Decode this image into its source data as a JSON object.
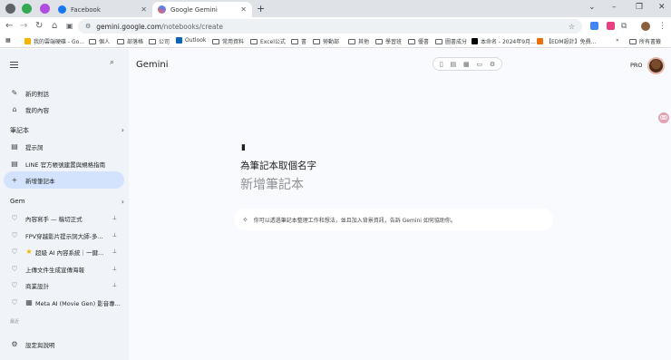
{
  "browser": {
    "tabs": [
      {
        "title": "Facebook",
        "active": false
      },
      {
        "title": "Google Gemini",
        "active": true
      }
    ],
    "new_tab": "+",
    "window_controls": [
      "⌄",
      "–",
      "❐",
      "✕"
    ],
    "url_host": "gemini.google.com",
    "url_path": "/notebooks/create"
  },
  "bookmarks": [
    {
      "label": "我的雲端硬碟 - Go...",
      "kind": "drive"
    },
    {
      "label": "個人",
      "kind": "folder"
    },
    {
      "label": "部落格",
      "kind": "folder"
    },
    {
      "label": "公司",
      "kind": "folder"
    },
    {
      "label": "Outlook",
      "kind": "outlook"
    },
    {
      "label": "常用資料",
      "kind": "folder"
    },
    {
      "label": "Excel公式",
      "kind": "folder"
    },
    {
      "label": "書",
      "kind": "folder"
    },
    {
      "label": "勞動部",
      "kind": "folder"
    },
    {
      "label": "其他",
      "kind": "folder"
    },
    {
      "label": "學習班",
      "kind": "folder"
    },
    {
      "label": "優書",
      "kind": "folder"
    },
    {
      "label": "圖書成分",
      "kind": "folder"
    },
    {
      "label": "本命名 - 2024年9月...",
      "kind": "notion"
    },
    {
      "label": "【EDM設計】免費...",
      "kind": "edm"
    },
    {
      "label": "所有書籤",
      "kind": "folder"
    }
  ],
  "sidebar": {
    "new_chat": "新的對話",
    "my_content": "我的內容",
    "notebooks_header": "筆記本",
    "notebooks": [
      "提示詞",
      "LINE 官方帳號建置與規格指南",
      "新增筆記本"
    ],
    "gems_header": "Gem",
    "gems": [
      "內容寫手 — 稿切正式",
      "FPV穿越影片提示詞大師-多...",
      "超級 AI 內容系統｜一鍵...",
      "上傳文件生成宣傳海報",
      "商業設計",
      "Meta AI (Movie Gen) 影音專..."
    ],
    "recent_label": "最近",
    "settings": "設定與說明"
  },
  "main": {
    "title": "Gemini",
    "pro": "PRO",
    "notebook_prompt": "為筆記本取個名字",
    "notebook_name_placeholder": "新增筆記本",
    "hint": "你可以透過筆記本整理工作和想法，並且加入背景資訊，告訴 Gemini 如何協助你。"
  },
  "colors": {
    "sidebar_bg": "#f0f4f9",
    "main_bg": "#f8fafd",
    "selected_row": "#d3e3fd",
    "tab_strip": "#dfe3e7"
  }
}
